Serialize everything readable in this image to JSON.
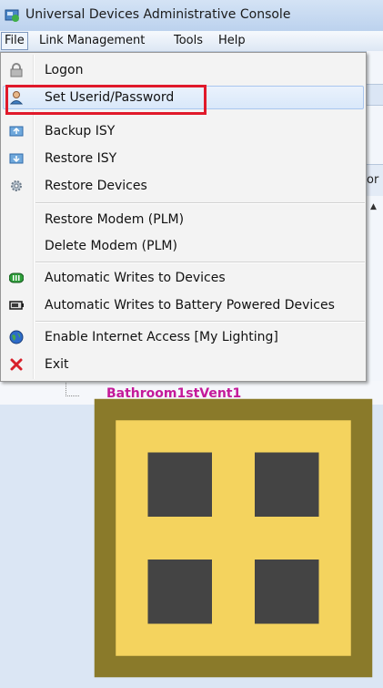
{
  "window": {
    "title": "Universal Devices Administrative Console"
  },
  "menubar": {
    "items": [
      {
        "label": "File"
      },
      {
        "label": "Link Management"
      },
      {
        "label": "Tools"
      },
      {
        "label": "Help"
      }
    ]
  },
  "file_menu": {
    "items": [
      {
        "label": "Logon",
        "icon": "lock-icon"
      },
      {
        "label": "Set Userid/Password",
        "icon": "user-icon"
      },
      {
        "label": "Backup ISY",
        "icon": "backup-icon"
      },
      {
        "label": "Restore ISY",
        "icon": "restore-icon"
      },
      {
        "label": "Restore Devices",
        "icon": "gear-icon"
      },
      {
        "label": "Restore Modem (PLM)",
        "icon": ""
      },
      {
        "label": "Delete Modem (PLM)",
        "icon": ""
      },
      {
        "label": "Automatic Writes to Devices",
        "icon": "device-write-icon"
      },
      {
        "label": "Automatic Writes to Battery Powered Devices",
        "icon": "battery-icon"
      },
      {
        "label": "Enable Internet Access  [My Lighting]",
        "icon": "globe-icon"
      },
      {
        "label": "Exit",
        "icon": "close-icon"
      }
    ],
    "highlight_color": "#e0192a"
  },
  "background": {
    "partial_text": "or",
    "tree_node": "Bathroom1stVent1",
    "tree_node_color": "#c41a9a"
  }
}
